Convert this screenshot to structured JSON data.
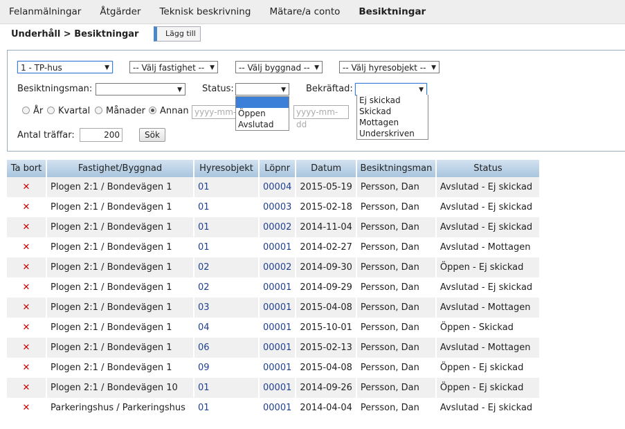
{
  "nav": {
    "tabs": [
      "Felanmälningar",
      "Åtgärder",
      "Teknisk beskrivning",
      "Mätare/a conto",
      "Besiktningar"
    ],
    "active": "Besiktningar"
  },
  "breadcrumb": "Underhåll > Besiktningar",
  "add_button": "Lägg till",
  "filters": {
    "company": "1 - TP-hus",
    "property": "-- Välj fastighet --",
    "building": "-- Välj byggnad --",
    "rental_object": "-- Välj hyresobjekt --",
    "inspector_label": "Besiktningsman:",
    "inspector_value": "",
    "status_label": "Status:",
    "status_value": "",
    "status_options": [
      "",
      "Öppen",
      "Avslutad"
    ],
    "confirmed_label": "Bekräftad:",
    "confirmed_value": "",
    "confirmed_options": [
      "Ej skickad",
      "Skickad",
      "Mottagen",
      "Underskriven"
    ],
    "period": {
      "year": "År",
      "quarter": "Kvartal",
      "month": "Månader",
      "other": "Annan"
    },
    "date_placeholder": "yyyy-mm-dd",
    "hits_label": "Antal träffar:",
    "hits_value": "200",
    "search_button": "Sök"
  },
  "table": {
    "columns": [
      "Ta bort",
      "Fastighet/Byggnad",
      "Hyresobjekt",
      "Löpnr",
      "Datum",
      "Besiktningsman",
      "Status"
    ],
    "delete_icon": "✕",
    "rows": [
      {
        "prop": "Plogen 2:1 / Bondevägen 1",
        "obj": "01",
        "nr": "00004",
        "date": "2015-05-19",
        "inspector": "Persson, Dan",
        "status": "Avslutad - Ej skickad"
      },
      {
        "prop": "Plogen 2:1 / Bondevägen 1",
        "obj": "01",
        "nr": "00003",
        "date": "2015-02-18",
        "inspector": "Persson, Dan",
        "status": "Avslutad - Ej skickad"
      },
      {
        "prop": "Plogen 2:1 / Bondevägen 1",
        "obj": "01",
        "nr": "00002",
        "date": "2014-11-04",
        "inspector": "Persson, Dan",
        "status": "Avslutad - Ej skickad"
      },
      {
        "prop": "Plogen 2:1 / Bondevägen 1",
        "obj": "01",
        "nr": "00001",
        "date": "2014-02-27",
        "inspector": "Persson, Dan",
        "status": "Avslutad - Mottagen"
      },
      {
        "prop": "Plogen 2:1 / Bondevägen 1",
        "obj": "02",
        "nr": "00002",
        "date": "2014-09-30",
        "inspector": "Persson, Dan",
        "status": "Öppen - Ej skickad"
      },
      {
        "prop": "Plogen 2:1 / Bondevägen 1",
        "obj": "02",
        "nr": "00001",
        "date": "2014-09-29",
        "inspector": "Persson, Dan",
        "status": "Avslutad - Ej skickad"
      },
      {
        "prop": "Plogen 2:1 / Bondevägen 1",
        "obj": "03",
        "nr": "00001",
        "date": "2015-04-08",
        "inspector": "Persson, Dan",
        "status": "Avslutad - Mottagen"
      },
      {
        "prop": "Plogen 2:1 / Bondevägen 1",
        "obj": "04",
        "nr": "00001",
        "date": "2015-10-01",
        "inspector": "Persson, Dan",
        "status": "Öppen - Skickad"
      },
      {
        "prop": "Plogen 2:1 / Bondevägen 1",
        "obj": "06",
        "nr": "00001",
        "date": "2015-02-13",
        "inspector": "Persson, Dan",
        "status": "Avslutad - Mottagen"
      },
      {
        "prop": "Plogen 2:1 / Bondevägen 1",
        "obj": "09",
        "nr": "00001",
        "date": "2015-04-08",
        "inspector": "Persson, Dan",
        "status": "Öppen - Ej skickad"
      },
      {
        "prop": "Plogen 2:1 / Bondevägen 10",
        "obj": "01",
        "nr": "00001",
        "date": "2014-09-26",
        "inspector": "Persson, Dan",
        "status": "Öppen - Ej skickad"
      },
      {
        "prop": "Parkeringshus / Parkeringshus",
        "obj": "01",
        "nr": "00001",
        "date": "2014-04-04",
        "inspector": "Persson, Dan",
        "status": "Avslutad - Ej skickad"
      }
    ]
  }
}
